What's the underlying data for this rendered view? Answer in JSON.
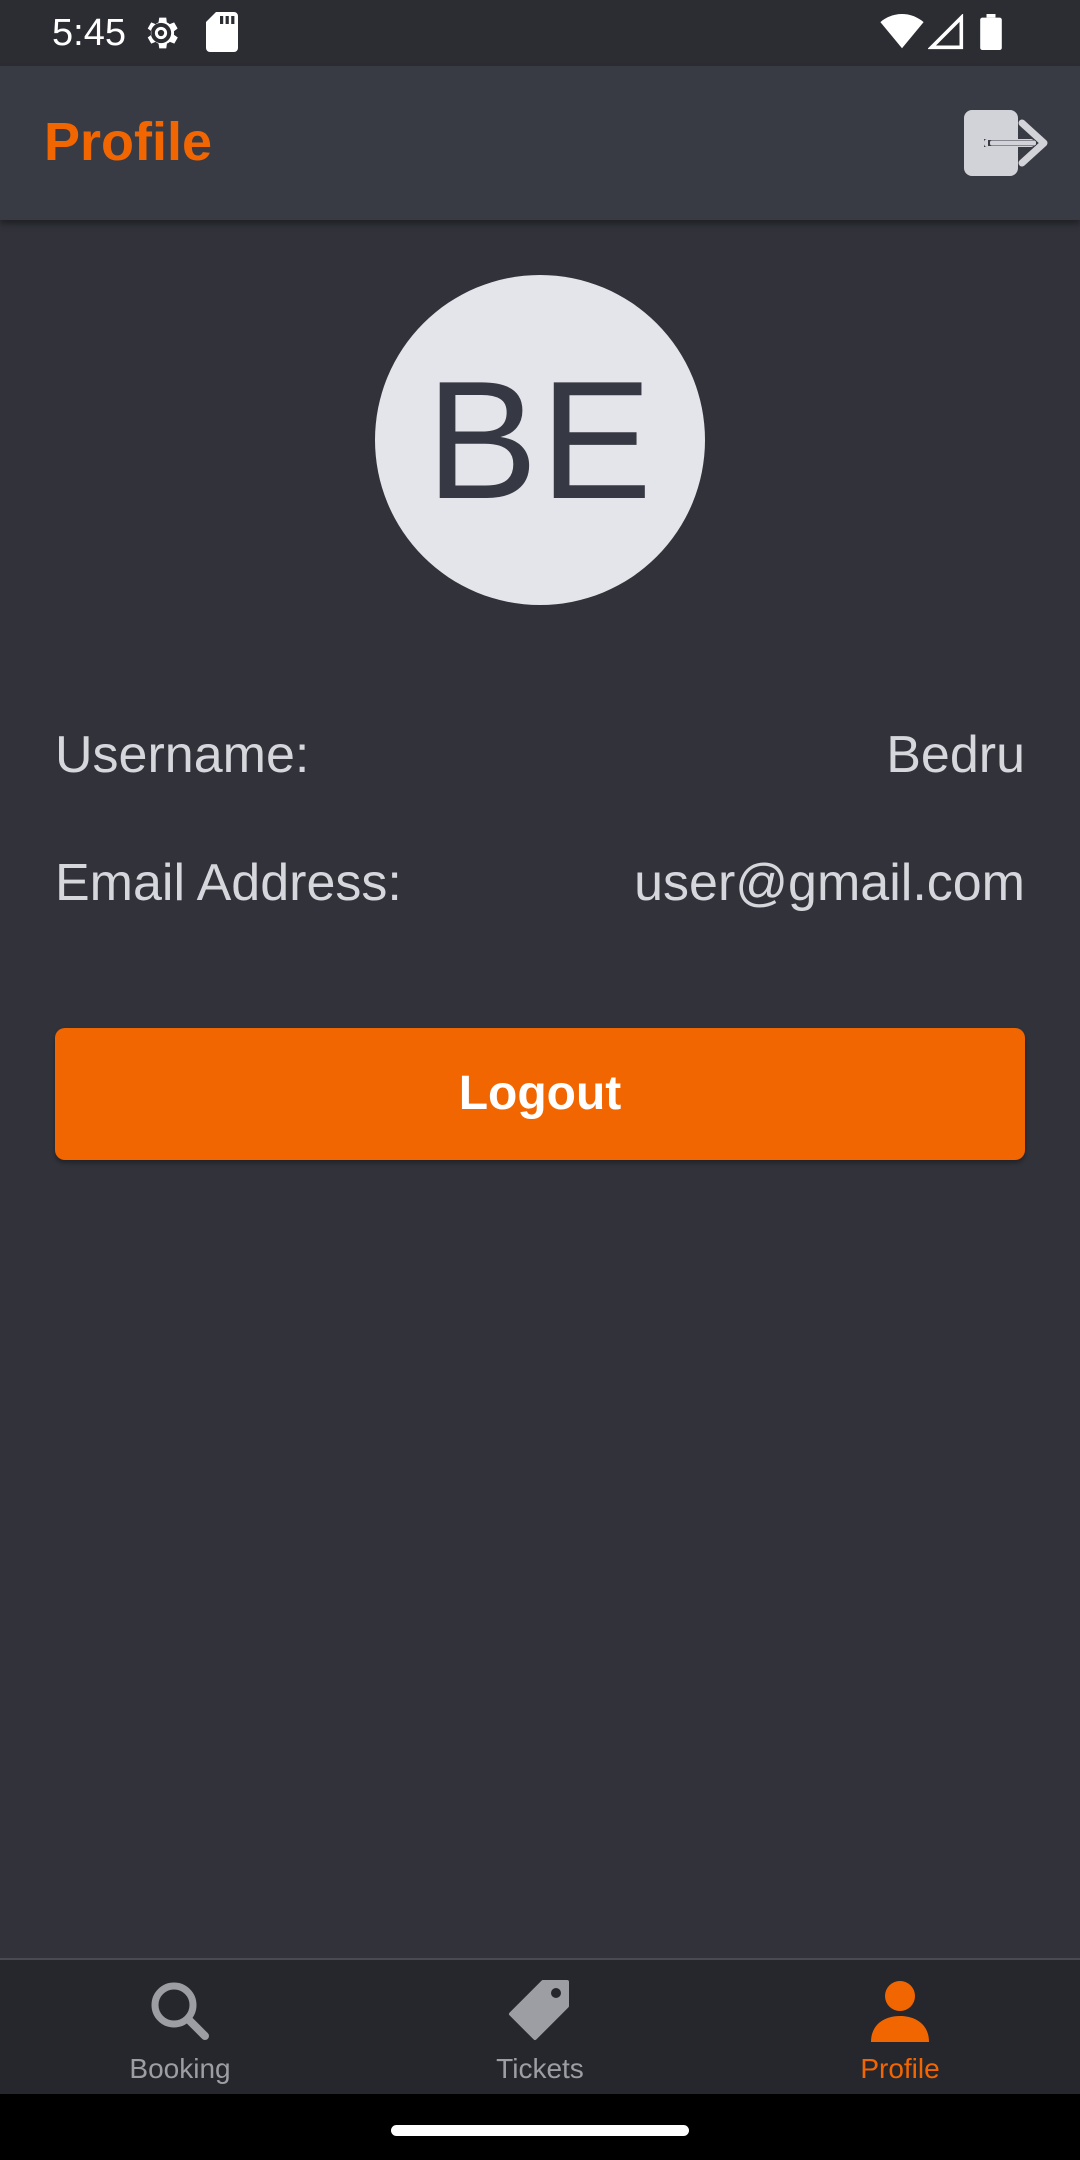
{
  "status_bar": {
    "time": "5:45",
    "icons_left": [
      "settings-gear-icon",
      "sd-card-icon"
    ],
    "icons_right": [
      "wifi-icon",
      "cell-signal-icon",
      "battery-icon"
    ]
  },
  "app_bar": {
    "title": "Profile",
    "action_icon": "logout-icon"
  },
  "profile": {
    "initials": "BE",
    "username_label": "Username:",
    "username_value": "Bedru",
    "email_label": "Email Address:",
    "email_value": "user@gmail.com"
  },
  "logout_button": {
    "label": "Logout"
  },
  "bottom_nav": {
    "items": [
      {
        "label": "Booking",
        "icon": "search-icon",
        "active": false
      },
      {
        "label": "Tickets",
        "icon": "tag-icon",
        "active": false
      },
      {
        "label": "Profile",
        "icon": "person-icon",
        "active": true
      }
    ]
  },
  "colors": {
    "accent": "#f26602",
    "background": "#31323a",
    "app_bar": "#383a44",
    "avatar_bg": "#e4e5ea",
    "nav_inactive": "#9d9ea4"
  }
}
